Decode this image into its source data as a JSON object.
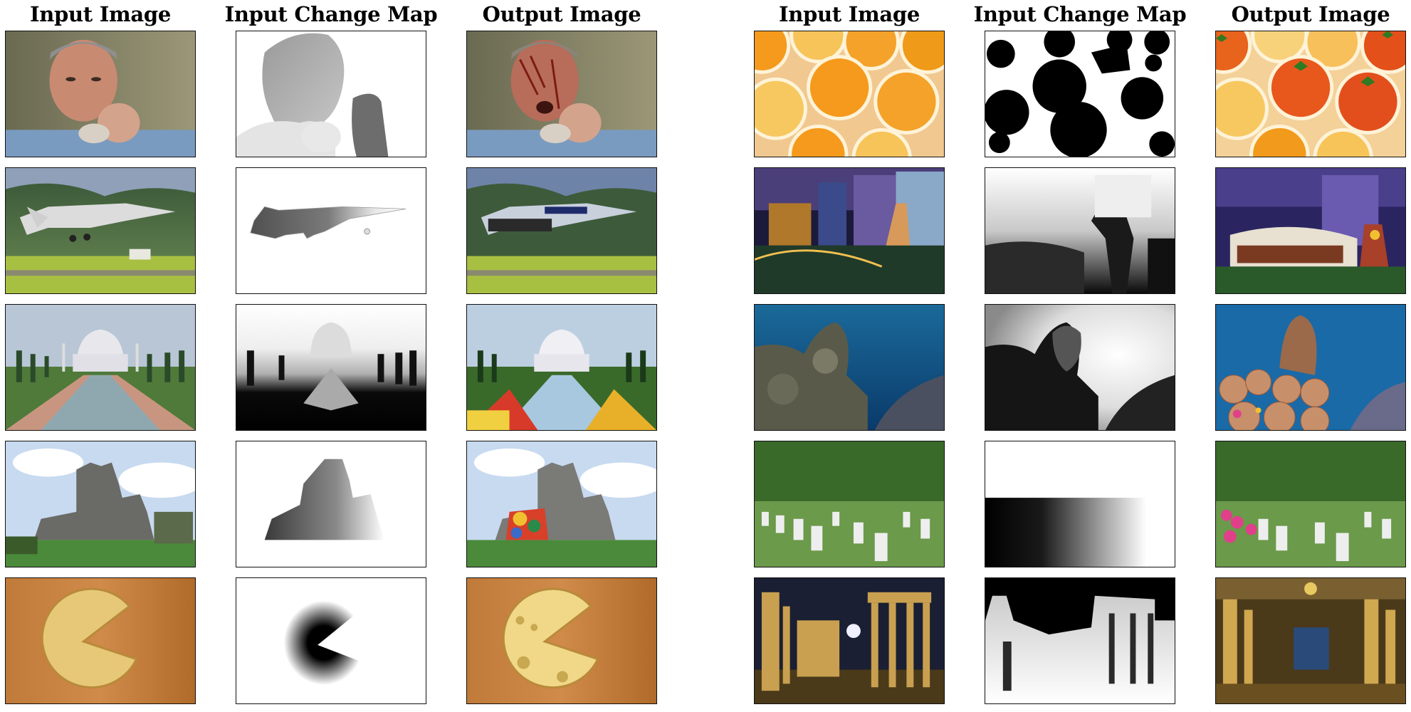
{
  "headers": {
    "left": [
      "Input Image",
      "Input Change Map",
      "Output Image"
    ],
    "right": [
      "Input Image",
      "Input Change Map",
      "Output Image"
    ]
  }
}
